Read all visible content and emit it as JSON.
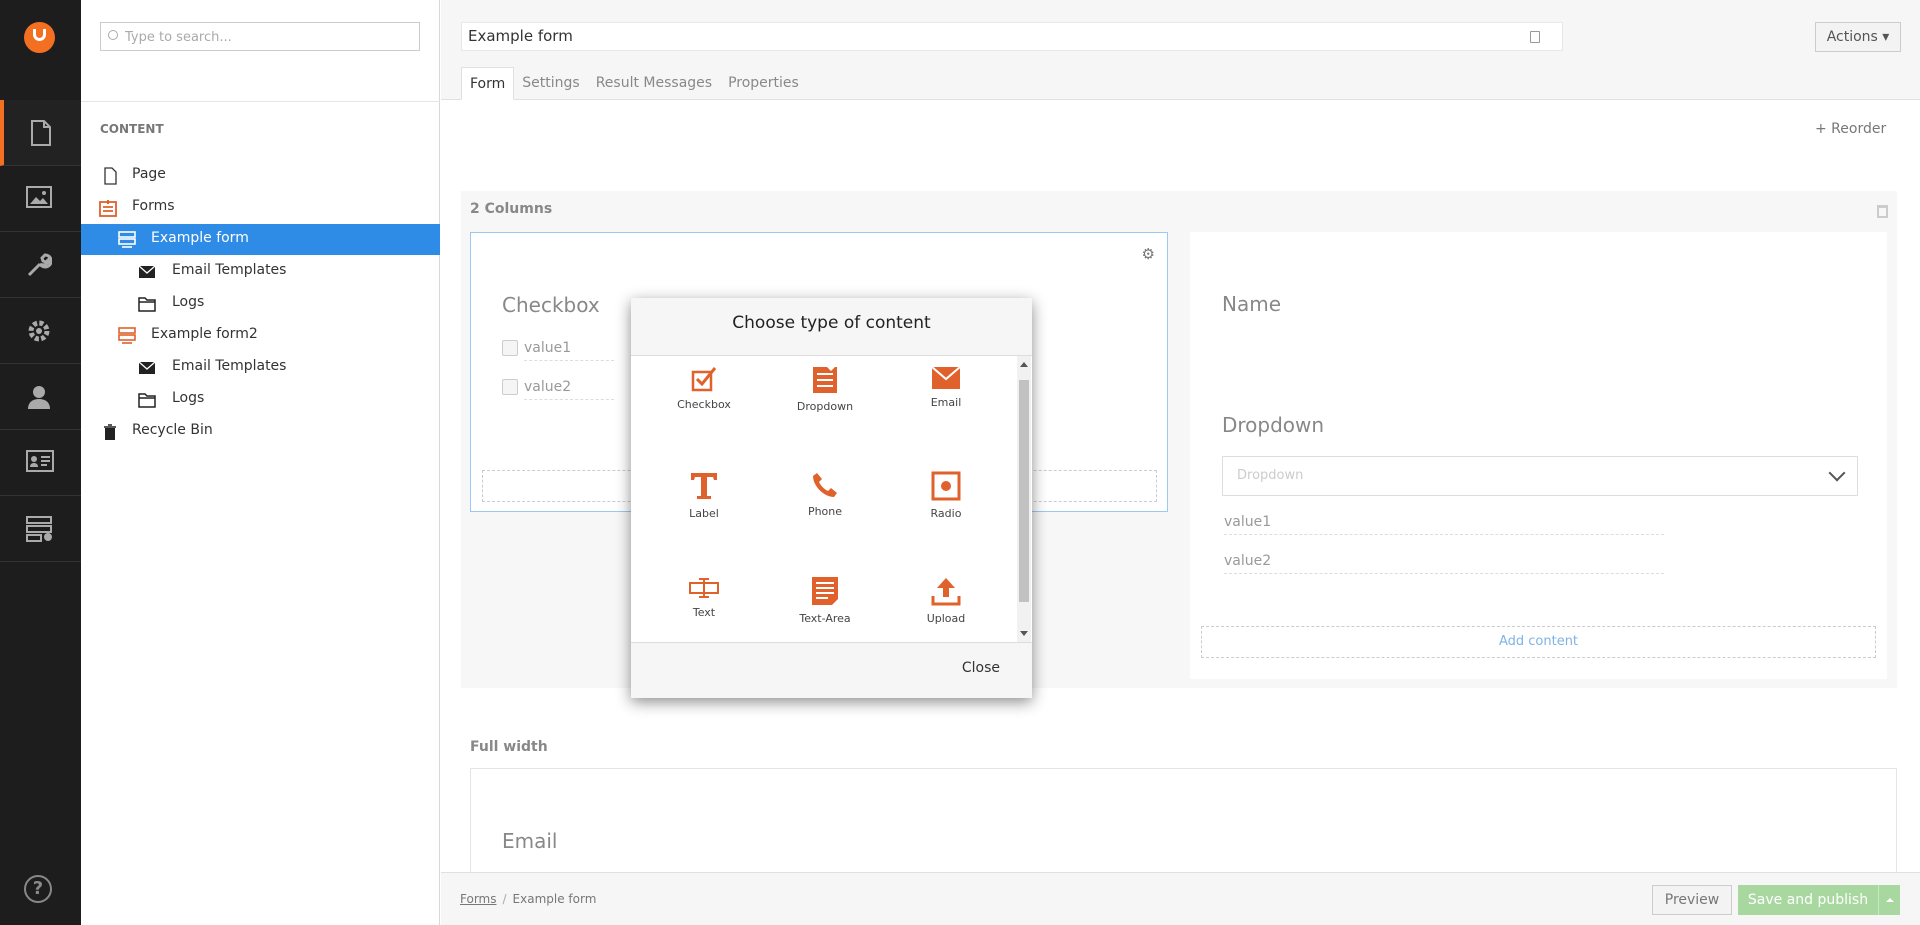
{
  "colors": {
    "accent": "#f36f22",
    "selected": "#2e8ce6",
    "rail": "#1d1d1d",
    "publish": "#a8d8a0"
  },
  "rail": {
    "items": [
      {
        "icon": "document-icon",
        "active": true
      },
      {
        "icon": "media-icon",
        "active": false
      },
      {
        "icon": "wrench-icon",
        "active": false
      },
      {
        "icon": "gear-icon",
        "active": false
      },
      {
        "icon": "user-icon",
        "active": false
      },
      {
        "icon": "member-card-icon",
        "active": false
      },
      {
        "icon": "forms-icon",
        "active": false
      }
    ],
    "help_label": "?"
  },
  "tree": {
    "search_placeholder": "Type to search...",
    "heading": "CONTENT",
    "items": [
      {
        "label": "Page",
        "icon": "page-icon"
      },
      {
        "label": "Forms",
        "icon": "forms-folder-icon"
      },
      {
        "label": "Example form",
        "icon": "form-icon",
        "selected": true
      },
      {
        "label": "Email Templates",
        "icon": "envelope-icon"
      },
      {
        "label": "Logs",
        "icon": "folder-icon"
      },
      {
        "label": "Example form2",
        "icon": "form-icon"
      },
      {
        "label": "Email Templates",
        "icon": "envelope-icon"
      },
      {
        "label": "Logs",
        "icon": "folder-icon"
      },
      {
        "label": "Recycle Bin",
        "icon": "trash-icon"
      }
    ]
  },
  "header": {
    "name": "Example form",
    "actions_label": "Actions ▾",
    "tabs": [
      "Form",
      "Settings",
      "Result Messages",
      "Properties"
    ]
  },
  "main": {
    "reorder_label": "+ Reorder",
    "row1": {
      "title": "2 Columns",
      "left": {
        "field_title": "Checkbox",
        "values": [
          "value1",
          "value2"
        ]
      },
      "right": {
        "field1_title": "Name",
        "field2_title": "Dropdown",
        "dropdown_placeholder": "Dropdown",
        "values": [
          "value1",
          "value2"
        ],
        "add_content_label": "Add content"
      }
    },
    "row2": {
      "title": "Full width",
      "field_title": "Email"
    }
  },
  "footer": {
    "breadcrumb": [
      "Forms",
      "Example form"
    ],
    "preview_label": "Preview",
    "publish_label": "Save and publish"
  },
  "modal": {
    "title": "Choose type of content",
    "types": [
      "Checkbox",
      "Dropdown",
      "Email",
      "Label",
      "Phone",
      "Radio",
      "Text",
      "Text-Area",
      "Upload"
    ],
    "close_label": "Close"
  }
}
